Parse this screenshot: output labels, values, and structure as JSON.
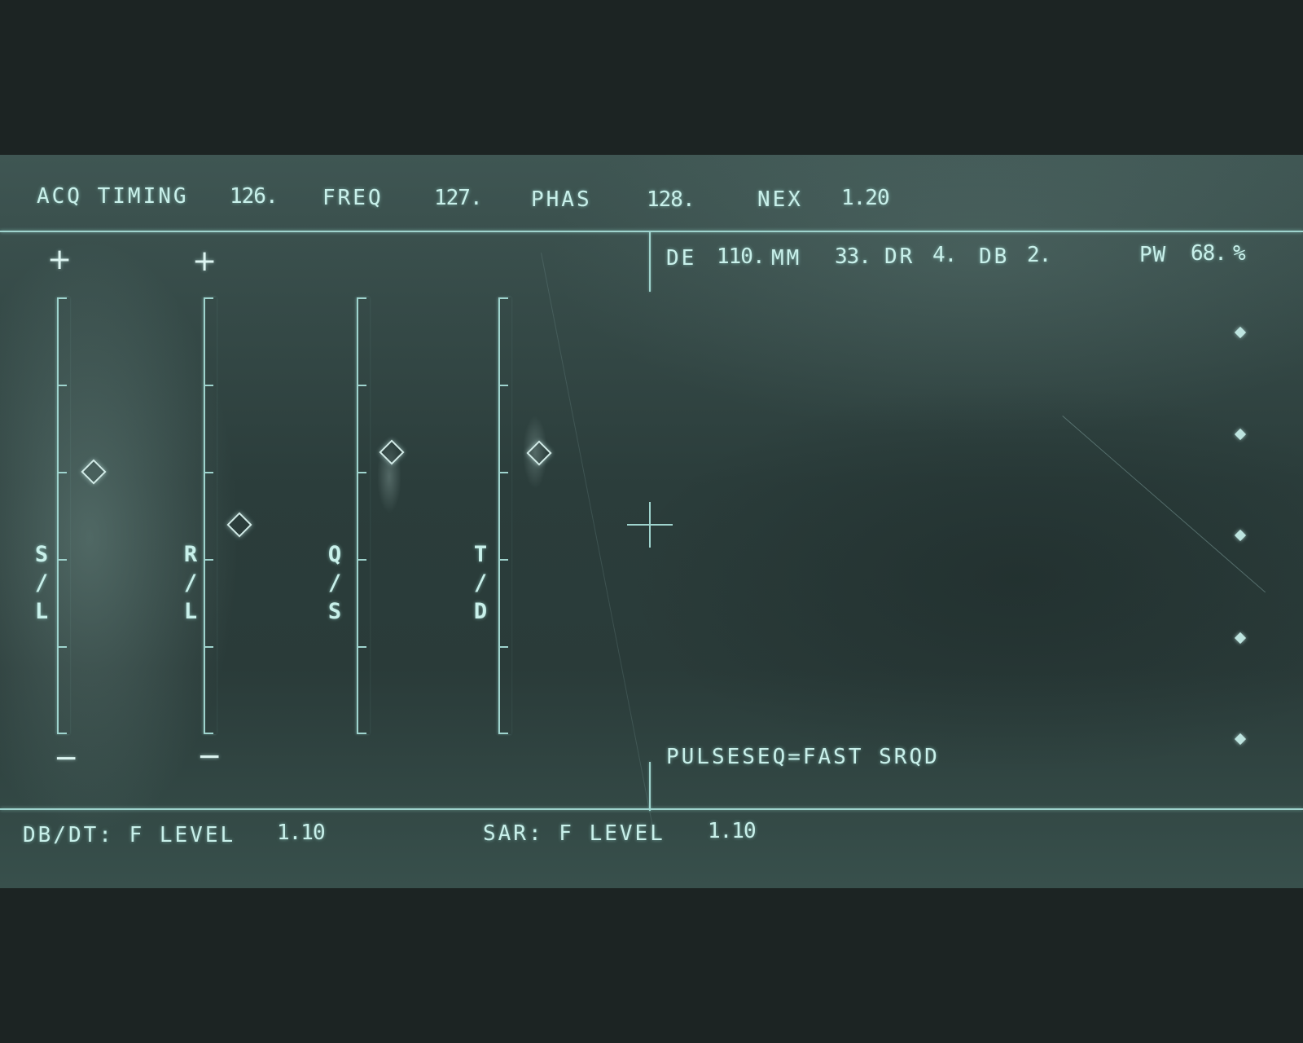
{
  "header": {
    "acq_timing_label": "ACQ TIMING",
    "acq_timing_value": "126.",
    "freq_label": "FREQ",
    "freq_value": "127.",
    "phas_label": "PHAS",
    "phas_value": "128.",
    "nex_label": "NEX",
    "nex_value": "1.20"
  },
  "params": {
    "de_label": "DE",
    "de_value": "110.",
    "mm_label": "MM",
    "mm_value": "33.",
    "dr_label": "DR",
    "dr_value": "4.",
    "db_label": "DB",
    "db_value": "2.",
    "pw_label": "PW",
    "pw_value": "68.",
    "pw_unit": "%"
  },
  "gauges": [
    {
      "letters": [
        "S",
        "/",
        "L"
      ],
      "plus": "+",
      "minus": "−"
    },
    {
      "letters": [
        "R",
        "/",
        "L"
      ],
      "plus": "+",
      "minus": "−"
    },
    {
      "letters": [
        "Q",
        "/",
        "S"
      ]
    },
    {
      "letters": [
        "T",
        "/",
        "D"
      ]
    }
  ],
  "pulse_sequence": "PULSESEQ=FAST SRQD",
  "footer": {
    "dbdt_label": "DB/DT: F LEVEL",
    "dbdt_value": "1.10",
    "sar_label": "SAR: F LEVEL",
    "sar_value": "1.10"
  },
  "colors": {
    "phosphor": "#c8f0ea",
    "screen": "#2b3d3b",
    "bezel": "#1c2423"
  }
}
